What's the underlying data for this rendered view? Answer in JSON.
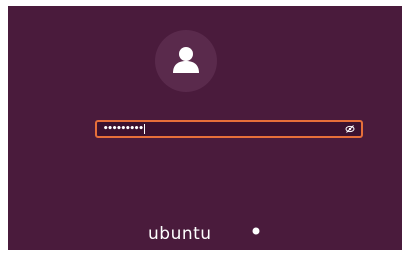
{
  "login": {
    "password_masked": "•••••••••",
    "avatar_icon": "user-silhouette-icon",
    "reveal_icon": "eye-icon"
  },
  "branding": {
    "logo_text": "ubuntu",
    "logo_mark_icon": "circle-of-friends-icon"
  },
  "colors": {
    "background": "#4a1b3c",
    "field_border": "#e66f3a",
    "text": "#ffffff"
  }
}
